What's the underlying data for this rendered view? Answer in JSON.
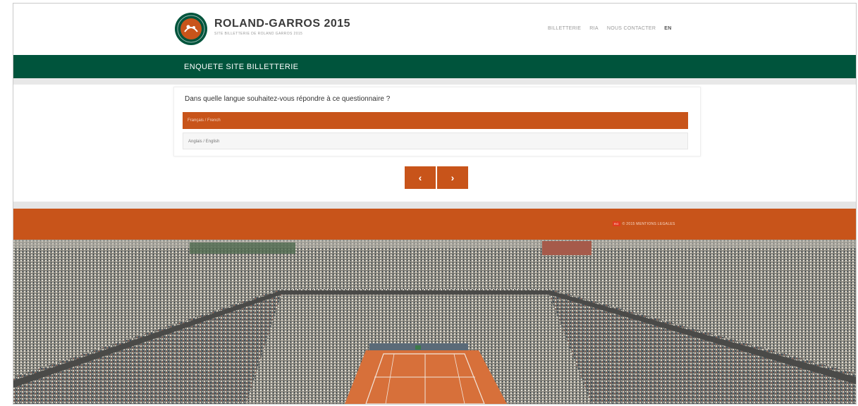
{
  "header": {
    "title": "ROLAND-GARROS 2015",
    "subtitle": "SITE BILLETTERIE DE ROLAND GARROS 2015",
    "nav": [
      "BILLETTERIE",
      "RIA",
      "NOUS CONTACTER"
    ],
    "lang": "EN"
  },
  "banner": {
    "title": "ENQUETE SITE BILLETTERIE"
  },
  "survey": {
    "question": "Dans quelle langue souhaitez-vous répondre à ce questionnaire ?",
    "options": [
      "Français / French",
      "Anglais / English"
    ],
    "selected_index": 0,
    "prev_label": "‹",
    "next_label": "›"
  },
  "footer": {
    "badge": "RG",
    "legal": "© 2015 MENTIONS LEGALES"
  },
  "colors": {
    "green": "#00543c",
    "clay_orange": "#c8541a",
    "clay_court": "#d7703a"
  },
  "icons": [
    "roland-garros-logo-icon",
    "chevron-left-icon",
    "chevron-right-icon"
  ]
}
